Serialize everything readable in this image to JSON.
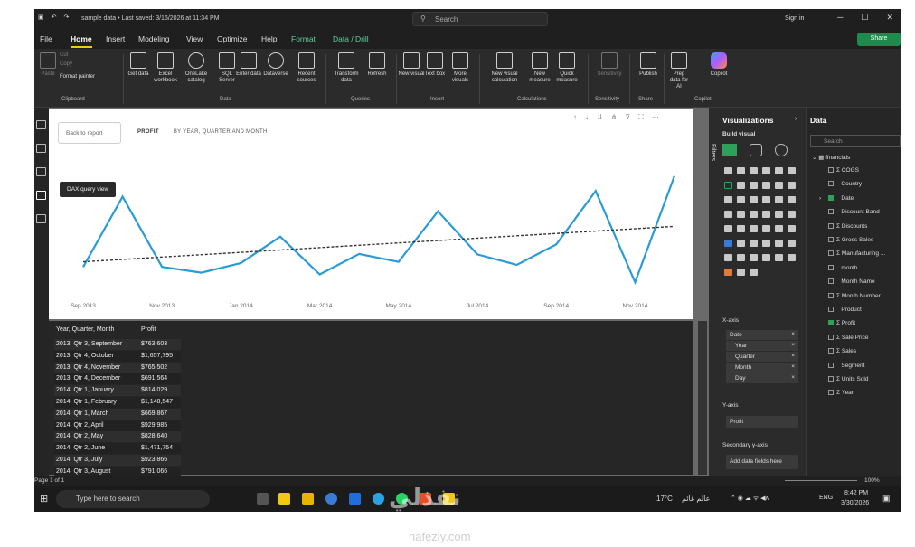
{
  "window": {
    "title": "sample data • Last saved: 3/16/2026 at 11:34 PM",
    "search_placeholder": "Search",
    "sign_in": "Sign in"
  },
  "menu": [
    "File",
    "Home",
    "Insert",
    "Modeling",
    "View",
    "Optimize",
    "Help",
    "Format",
    "Data / Drill"
  ],
  "share_label": "Share",
  "ribbon": {
    "clipboard": {
      "paste": "Paste",
      "cut": "Cut",
      "copy": "Copy",
      "format_painter": "Format painter",
      "group": "Clipboard"
    },
    "data": {
      "buttons": [
        "Get data",
        "Excel workbook",
        "OneLake catalog",
        "SQL Server",
        "Enter data",
        "Dataverse",
        "Recent sources"
      ],
      "group": "Data"
    },
    "queries": {
      "buttons": [
        "Transform data",
        "Refresh"
      ],
      "group": "Queries"
    },
    "insert": {
      "buttons": [
        "New visual",
        "Text box",
        "More visuals"
      ],
      "group": "Insert"
    },
    "calculations": {
      "buttons": [
        "New visual calculation",
        "New measure",
        "Quick measure"
      ],
      "group": "Calculations"
    },
    "sensitivity": {
      "buttons": [
        "Sensitivity"
      ],
      "group": "Sensitivity"
    },
    "share": {
      "buttons": [
        "Publish"
      ],
      "group": "Share"
    },
    "copilot": {
      "buttons": [
        "Prep data for AI",
        "Copilot"
      ],
      "group": "Copilot"
    }
  },
  "left_tooltip": "DAX query view",
  "visual": {
    "back_button": "Back to report",
    "crumb_main": "PROFIT",
    "crumb_sub": "BY YEAR, QUARTER AND MONTH"
  },
  "chart_data": {
    "type": "line",
    "x_tick_labels": [
      "Sep 2013",
      "Nov 2013",
      "Jan 2014",
      "Mar 2014",
      "May 2014",
      "Jul 2014",
      "Sep 2014",
      "Nov 2014"
    ],
    "x": [
      "Sep 2013",
      "Oct 2013",
      "Nov 2013",
      "Dec 2013",
      "Jan 2014",
      "Feb 2014",
      "Mar 2014",
      "Apr 2014",
      "May 2014",
      "Jun 2014",
      "Jul 2014",
      "Aug 2014",
      "Sep 2014",
      "Oct 2014",
      "Nov 2014",
      "Dec 2014"
    ],
    "series": [
      {
        "values": [
          763603,
          1657795,
          765502,
          691564,
          814029,
          1148547,
          669867,
          929985,
          828640,
          1471754,
          923866,
          791066,
          1050000,
          1730000,
          570000,
          1920000
        ],
        "color": "#2b9bd6"
      }
    ],
    "trendline": {
      "start": 830000,
      "end": 1280000,
      "style": "dashed",
      "color": "#333333"
    },
    "ylim": [
      400000,
      2100000
    ],
    "grid": false
  },
  "table": {
    "headers": [
      "Year, Quarter, Month",
      "Profit"
    ],
    "rows": [
      [
        "2013, Qtr 3, September",
        "$763,603"
      ],
      [
        "2013, Qtr 4, October",
        "$1,657,795"
      ],
      [
        "2013, Qtr 4, November",
        "$765,502"
      ],
      [
        "2013, Qtr 4, December",
        "$691,564"
      ],
      [
        "2014, Qtr 1, January",
        "$814,029"
      ],
      [
        "2014, Qtr 1, February",
        "$1,148,547"
      ],
      [
        "2014, Qtr 1, March",
        "$669,867"
      ],
      [
        "2014, Qtr 2, April",
        "$929,985"
      ],
      [
        "2014, Qtr 2, May",
        "$828,640"
      ],
      [
        "2014, Qtr 2, June",
        "$1,471,754"
      ],
      [
        "2014, Qtr 3, July",
        "$923,866"
      ],
      [
        "2014, Qtr 3, August",
        "$791,066"
      ]
    ]
  },
  "filters_label": "Filters",
  "viz_pane": {
    "title": "Visualizations",
    "build_visual": "Build visual",
    "xaxis_label": "X-axis",
    "xaxis_fields": [
      "Date",
      "Year",
      "Quarter",
      "Month",
      "Day"
    ],
    "yaxis_label": "Y-axis",
    "yaxis_field": "Profit",
    "secondary_label": "Secondary y-axis",
    "secondary_placeholder": "Add data fields here"
  },
  "data_pane": {
    "title": "Data",
    "search_placeholder": "Search",
    "table": "financials",
    "fields": [
      {
        "label": "COGS",
        "sigma": true,
        "checked": false
      },
      {
        "label": "Country",
        "sigma": false,
        "checked": false
      },
      {
        "label": "Date",
        "sigma": false,
        "checked": true,
        "expand": true
      },
      {
        "label": "Discount Band",
        "sigma": false,
        "checked": false
      },
      {
        "label": "Discounts",
        "sigma": true,
        "checked": false
      },
      {
        "label": "Gross Sales",
        "sigma": true,
        "checked": false
      },
      {
        "label": "Manufacturing ...",
        "sigma": true,
        "checked": false
      },
      {
        "label": "month",
        "sigma": false,
        "checked": false
      },
      {
        "label": "Month Name",
        "sigma": false,
        "checked": false
      },
      {
        "label": "Month Number",
        "sigma": true,
        "checked": false
      },
      {
        "label": "Product",
        "sigma": false,
        "checked": false
      },
      {
        "label": "Profit",
        "sigma": true,
        "checked": true
      },
      {
        "label": "Sale Price",
        "sigma": true,
        "checked": false
      },
      {
        "label": "Sales",
        "sigma": true,
        "checked": false
      },
      {
        "label": "Segment",
        "sigma": false,
        "checked": false
      },
      {
        "label": "Units Sold",
        "sigma": true,
        "checked": false
      },
      {
        "label": "Year",
        "sigma": true,
        "checked": false
      }
    ]
  },
  "status": {
    "page": "Page 1 of 1",
    "zoom": "100%"
  },
  "taskbar": {
    "search_placeholder": "Type here to search",
    "weather": "17°C",
    "weather_desc": "عالم غائم",
    "lang": "ENG",
    "time": "8:42 PM",
    "date": "3/30/2026"
  },
  "watermark": {
    "arabic": "نفذلي",
    "latin": "nafezly.com"
  }
}
